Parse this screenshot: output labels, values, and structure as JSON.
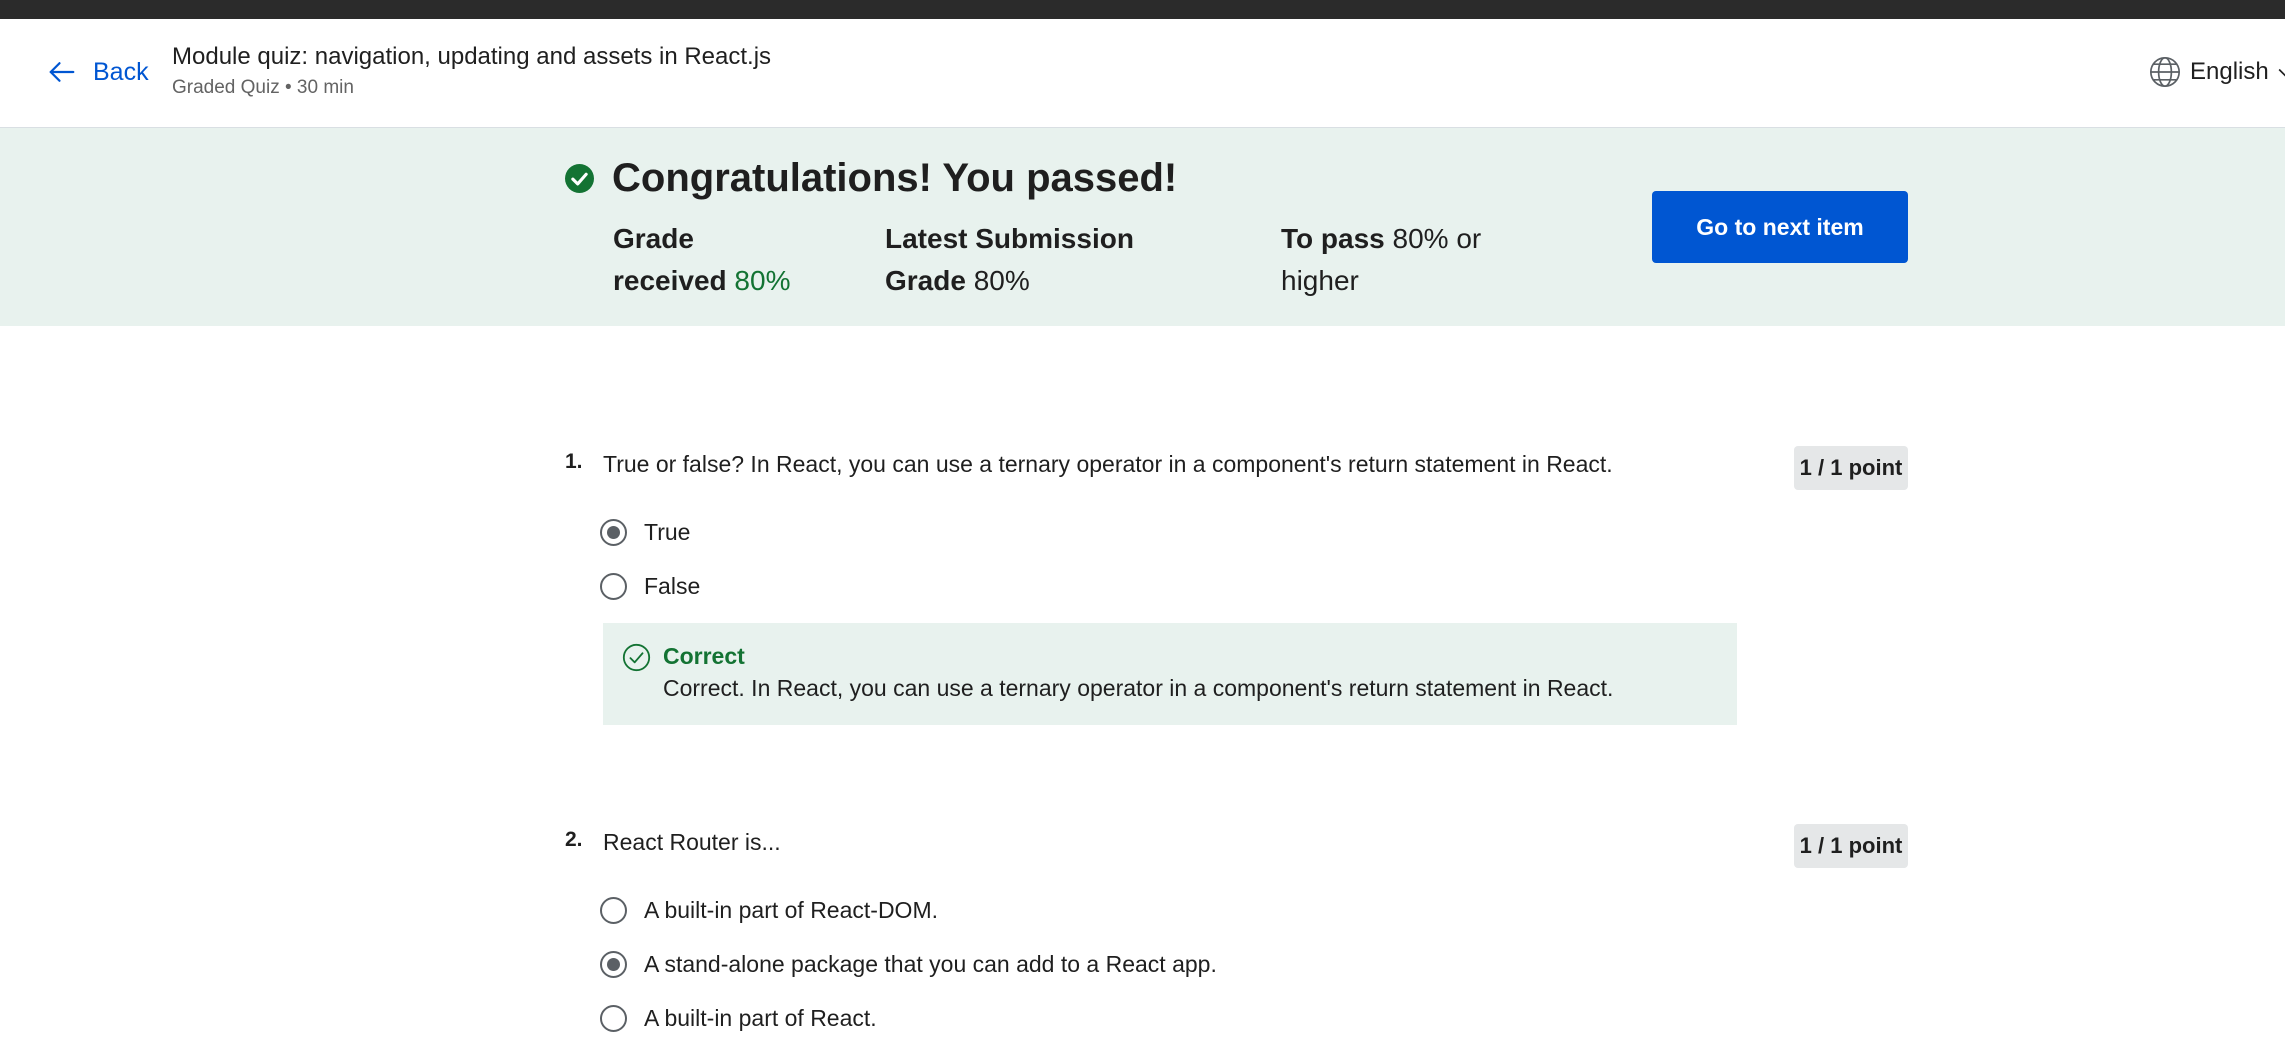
{
  "header": {
    "back_label": "Back",
    "title": "Module quiz: navigation, updating and assets in React.js",
    "subtitle": "Graded Quiz • 30 min",
    "language": "English"
  },
  "banner": {
    "heading": "Congratulations! You passed!",
    "grade_label_1": "Grade",
    "grade_label_2": "received",
    "grade_value": "80%",
    "latest_label_1": "Latest Submission",
    "latest_label_2": "Grade",
    "latest_value": "80%",
    "pass_label": "To pass",
    "pass_value": "80% or",
    "pass_value_2": "higher",
    "next_button": "Go to next item"
  },
  "questions": [
    {
      "number": "1.",
      "text": "True or false? In React, you can use a ternary operator in a component's return statement in React.",
      "points": "1 / 1 point",
      "options": [
        {
          "label": "True",
          "selected": true
        },
        {
          "label": "False",
          "selected": false
        }
      ],
      "feedback": {
        "heading": "Correct",
        "body": "Correct. In React, you can use a ternary operator in a component's return statement in React."
      }
    },
    {
      "number": "2.",
      "text": "React Router is...",
      "points": "1 / 1 point",
      "options": [
        {
          "label": "A built-in part of React-DOM.",
          "selected": false
        },
        {
          "label": "A stand-alone package that you can add to a React app.",
          "selected": true
        },
        {
          "label": "A built-in part of React.",
          "selected": false
        }
      ]
    }
  ],
  "colors": {
    "accent": "#0056d2",
    "success": "#137333",
    "banner_bg": "#e8f2ee"
  },
  "icons": {
    "back": "arrow-left-icon",
    "language": "globe-icon",
    "dropdown": "chevron-down-icon",
    "passed": "check-circle-filled-icon",
    "correct": "check-circle-outline-icon"
  }
}
